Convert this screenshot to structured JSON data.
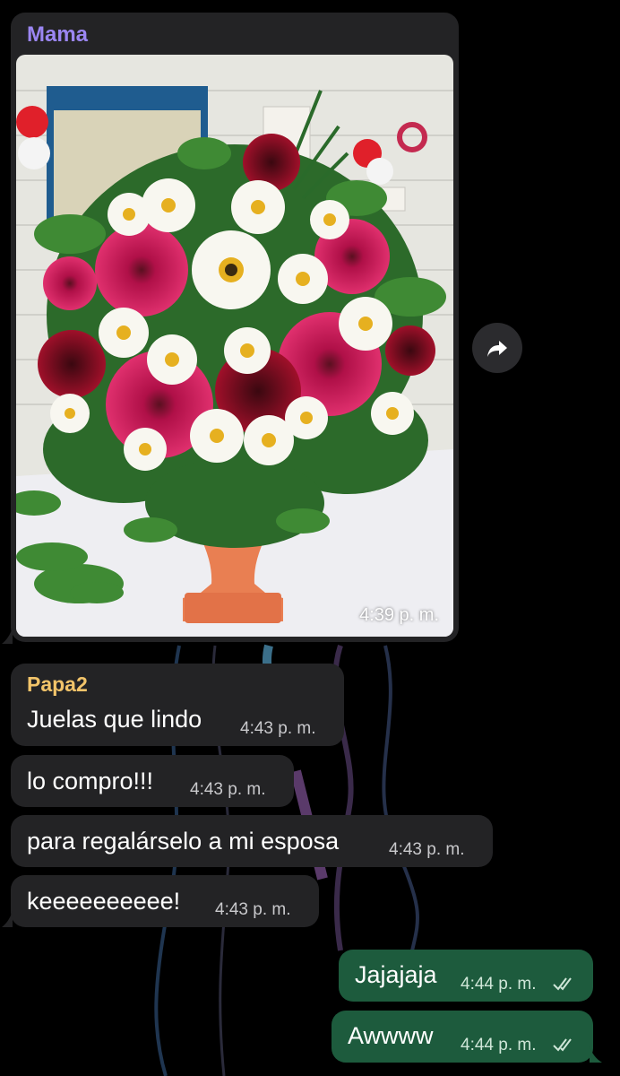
{
  "messages": [
    {
      "sender": "Mama",
      "time": "4:39 p. m.",
      "image": "flower-arrangement-photo"
    },
    {
      "sender": "Papa2",
      "text": "Juelas que lindo",
      "time": "4:43 p. m."
    },
    {
      "text": "lo compro!!!",
      "time": "4:43 p. m."
    },
    {
      "text": "para regalárselo a mi esposa",
      "time": "4:43 p. m."
    },
    {
      "text": "keeeeeeeeee!",
      "time": "4:43 p. m."
    }
  ],
  "outgoing": [
    {
      "text": "Jajajaja",
      "time": "4:44 p. m.",
      "status": "read"
    },
    {
      "text": "Awwww",
      "time": "4:44 p. m.",
      "status": "read"
    }
  ],
  "colors": {
    "background": "#000000",
    "incoming_bubble": "#232325",
    "outgoing_bubble": "#1d5b3d",
    "sender_mama": "#9b86f2",
    "sender_papa": "#f2c46a"
  },
  "icons": [
    "forward-icon",
    "double-check-icon"
  ]
}
